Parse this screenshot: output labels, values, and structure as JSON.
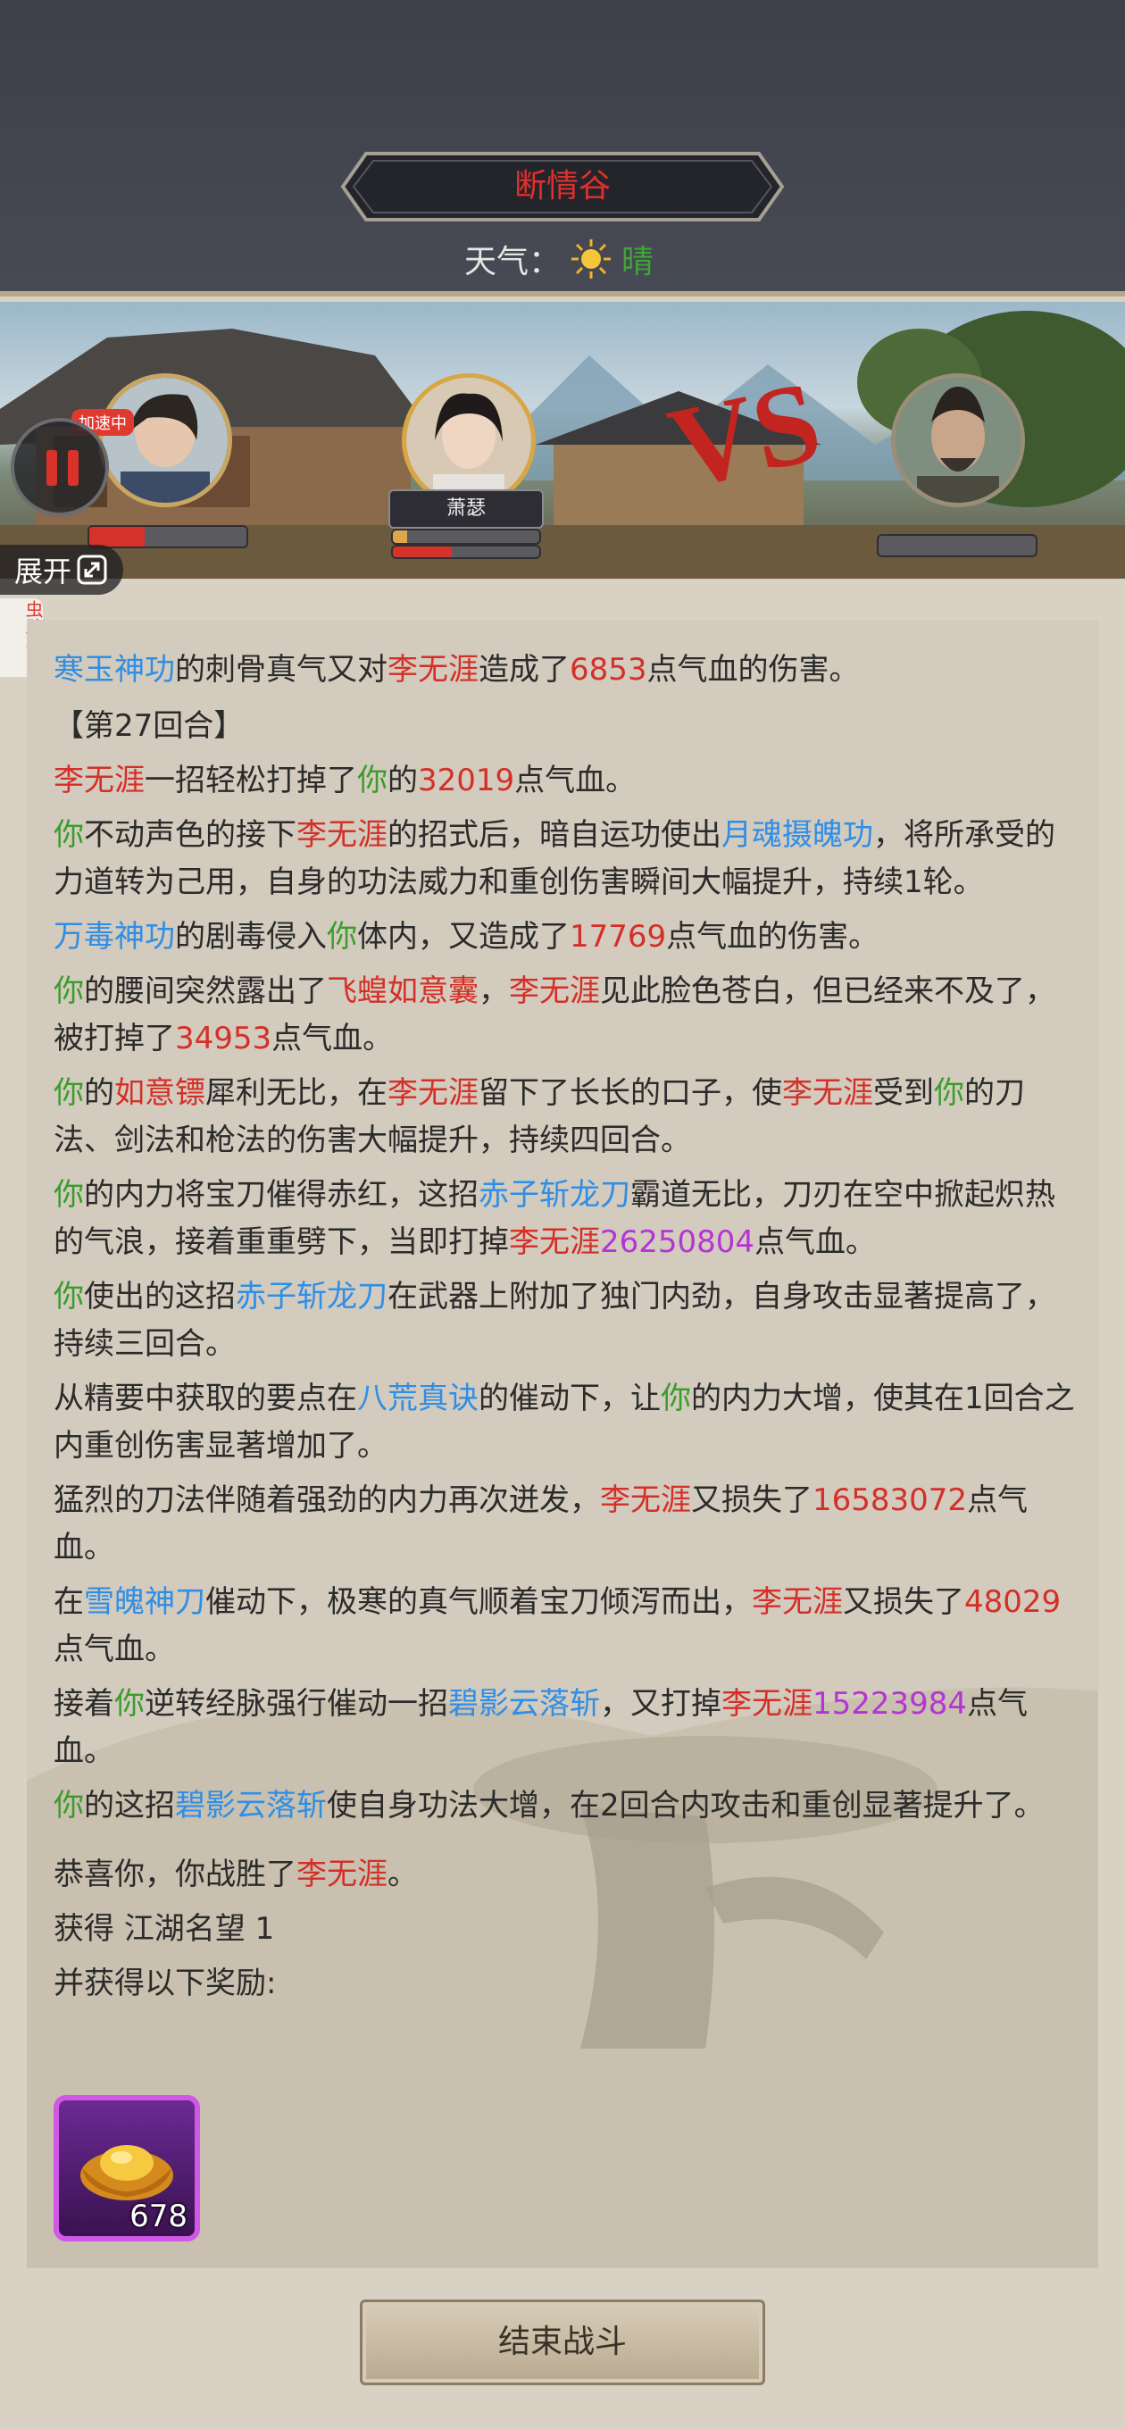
{
  "header": {
    "location": "断情谷",
    "weather_label": "天气：",
    "weather_value": "晴"
  },
  "battle": {
    "speed_badge": "加速中",
    "ally_name": "萧瑟",
    "player_hp_fraction": 0.35,
    "ally_hp_fraction": 0.1,
    "ally_mp_fraction": 0.4,
    "enemy_hp_fraction": 0.0
  },
  "controls": {
    "expand_label": "展开",
    "side_tab_label": "虫助手",
    "end_battle": "结束战斗"
  },
  "log": {
    "line1": [
      "寒玉神功",
      "的刺骨真气又对",
      "李无涯",
      "造成了",
      "6853",
      "点气血的伤害。"
    ],
    "round_title": "【第27回合】",
    "line2": [
      "李无涯",
      "一招轻松打掉了",
      "你",
      "的",
      "32019",
      "点气血。"
    ],
    "line3": [
      "你",
      "不动声色的接下",
      "李无涯",
      "的招式后，暗自运功使出",
      "月魂摄魄功",
      "，将所承受的力道转为己用，自身的功法威力和重创伤害瞬间大幅提升，持续1轮。"
    ],
    "line4": [
      "万毒神功",
      "的剧毒侵入",
      "你",
      "体内，又造成了",
      "17769",
      "点气血的伤害。"
    ],
    "line5": [
      "你",
      "的腰间突然露出了",
      "飞蝗如意囊",
      "，",
      "李无涯",
      "见此脸色苍白，但已经来不及了，被打掉了",
      "34953",
      "点气血。"
    ],
    "line6": [
      "你",
      "的",
      "如意镖",
      "犀利无比，在",
      "李无涯",
      "留下了长长的口子，使",
      "李无涯",
      "受到",
      "你",
      "的刀法、剑法和枪法的伤害大幅提升，持续四回合。"
    ],
    "line7": [
      "你",
      "的内力将宝刀催得赤红，这招",
      "赤子斩龙刀",
      "霸道无比，刀刃在空中掀起炽热的气浪，接着重重劈下，当即打掉",
      "李无涯",
      "26250804",
      "点气血。"
    ],
    "line8": [
      "你",
      "使出的这招",
      "赤子斩龙刀",
      "在武器上附加了独门内劲，自身攻击显著提高了，持续三回合。"
    ],
    "line9": [
      "从精要中获取的要点在",
      "八荒真诀",
      "的催动下，让",
      "你",
      "的内力大增，使其在1回合之内重创伤害显著增加了。"
    ],
    "line10": [
      "猛烈的刀法伴随着强劲的内力再次迸发，",
      "李无涯",
      "又损失了",
      "16583072",
      "点气血。"
    ],
    "line11": [
      "在",
      "雪魄神刀",
      "催动下，极寒的真气顺着宝刀倾泻而出，",
      "李无涯",
      "又损失了",
      "48029",
      "点气血。"
    ],
    "line12": [
      "接着",
      "你",
      "逆转经脉强行催动一招",
      "碧影云落斩",
      "，又打掉",
      "李无涯",
      "15223984",
      "点气血。"
    ],
    "line13": [
      "你",
      "的这招",
      "碧影云落斩",
      "使自身功法大增，在2回合内攻击和重创显著提升了。"
    ],
    "victory": [
      "恭喜你，你战胜了",
      "李无涯",
      "。"
    ],
    "reputation": [
      "获得 ",
      "江湖名望",
      " 1"
    ],
    "reward_intro": "并获得以下奖励:"
  },
  "reward": {
    "item_icon": "gold-ingot-icon",
    "count": "678"
  },
  "colors": {
    "name_red": "#d42f28",
    "you_green": "#3a9c2c",
    "skill_blue": "#2f8ee6",
    "big_damage_purple": "#b634d6",
    "reward_border": "#d058e6"
  }
}
